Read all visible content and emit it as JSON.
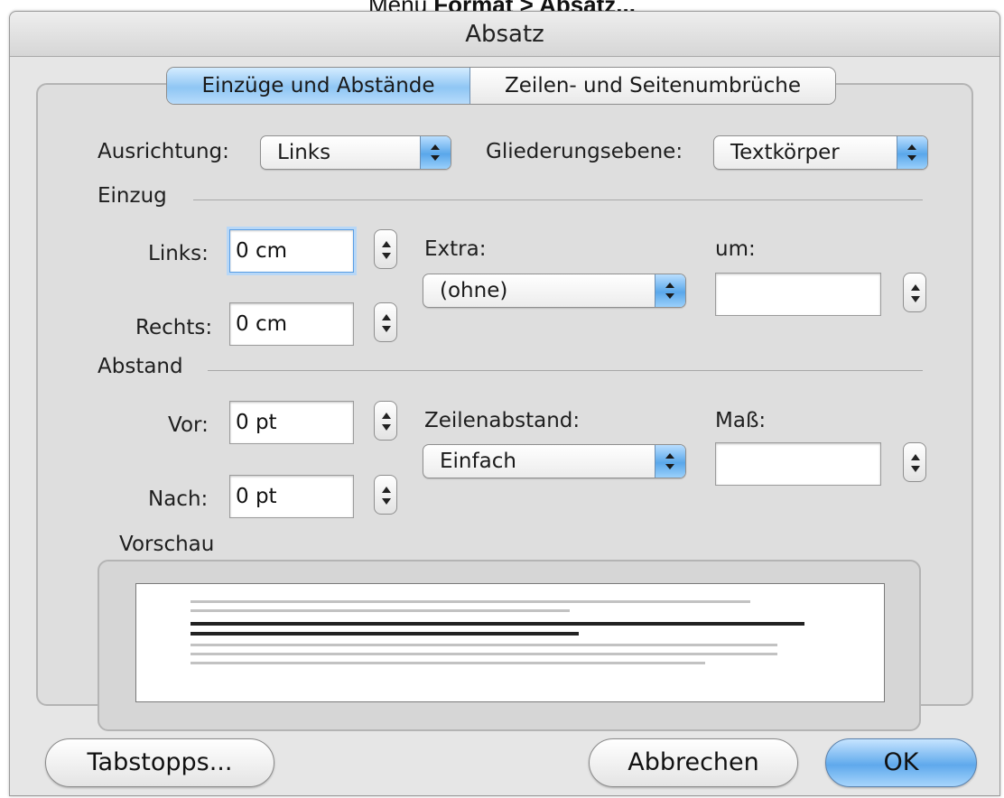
{
  "caption": {
    "prefix": "Menü ",
    "path": "Format > Absatz..."
  },
  "window": {
    "title": "Absatz"
  },
  "tabs": [
    {
      "label": "Einzüge und Abstände",
      "selected": true
    },
    {
      "label": "Zeilen- und Seitenumbrüche",
      "selected": false
    }
  ],
  "alignment": {
    "label": "Ausrichtung:",
    "value": "Links"
  },
  "outline_level": {
    "label": "Gliederungsebene:",
    "value": "Textkörper"
  },
  "indent": {
    "section_label": "Einzug",
    "left_label": "Links:",
    "left_value": "0 cm",
    "right_label": "Rechts:",
    "right_value": "0 cm",
    "special_label": "Extra:",
    "special_value": "(ohne)",
    "by_label": "um:",
    "by_value": ""
  },
  "spacing": {
    "section_label": "Abstand",
    "before_label": "Vor:",
    "before_value": "0 pt",
    "after_label": "Nach:",
    "after_value": "0 pt",
    "line_spacing_label": "Zeilenabstand:",
    "line_spacing_value": "Einfach",
    "at_label": "Maß:",
    "at_value": ""
  },
  "preview": {
    "label": "Vorschau"
  },
  "buttons": {
    "tabs": "Tabstopps...",
    "cancel": "Abbrechen",
    "ok": "OK"
  },
  "colors": {
    "accent": "#5fa9ec",
    "dialog_bg": "#e6e6e6"
  }
}
